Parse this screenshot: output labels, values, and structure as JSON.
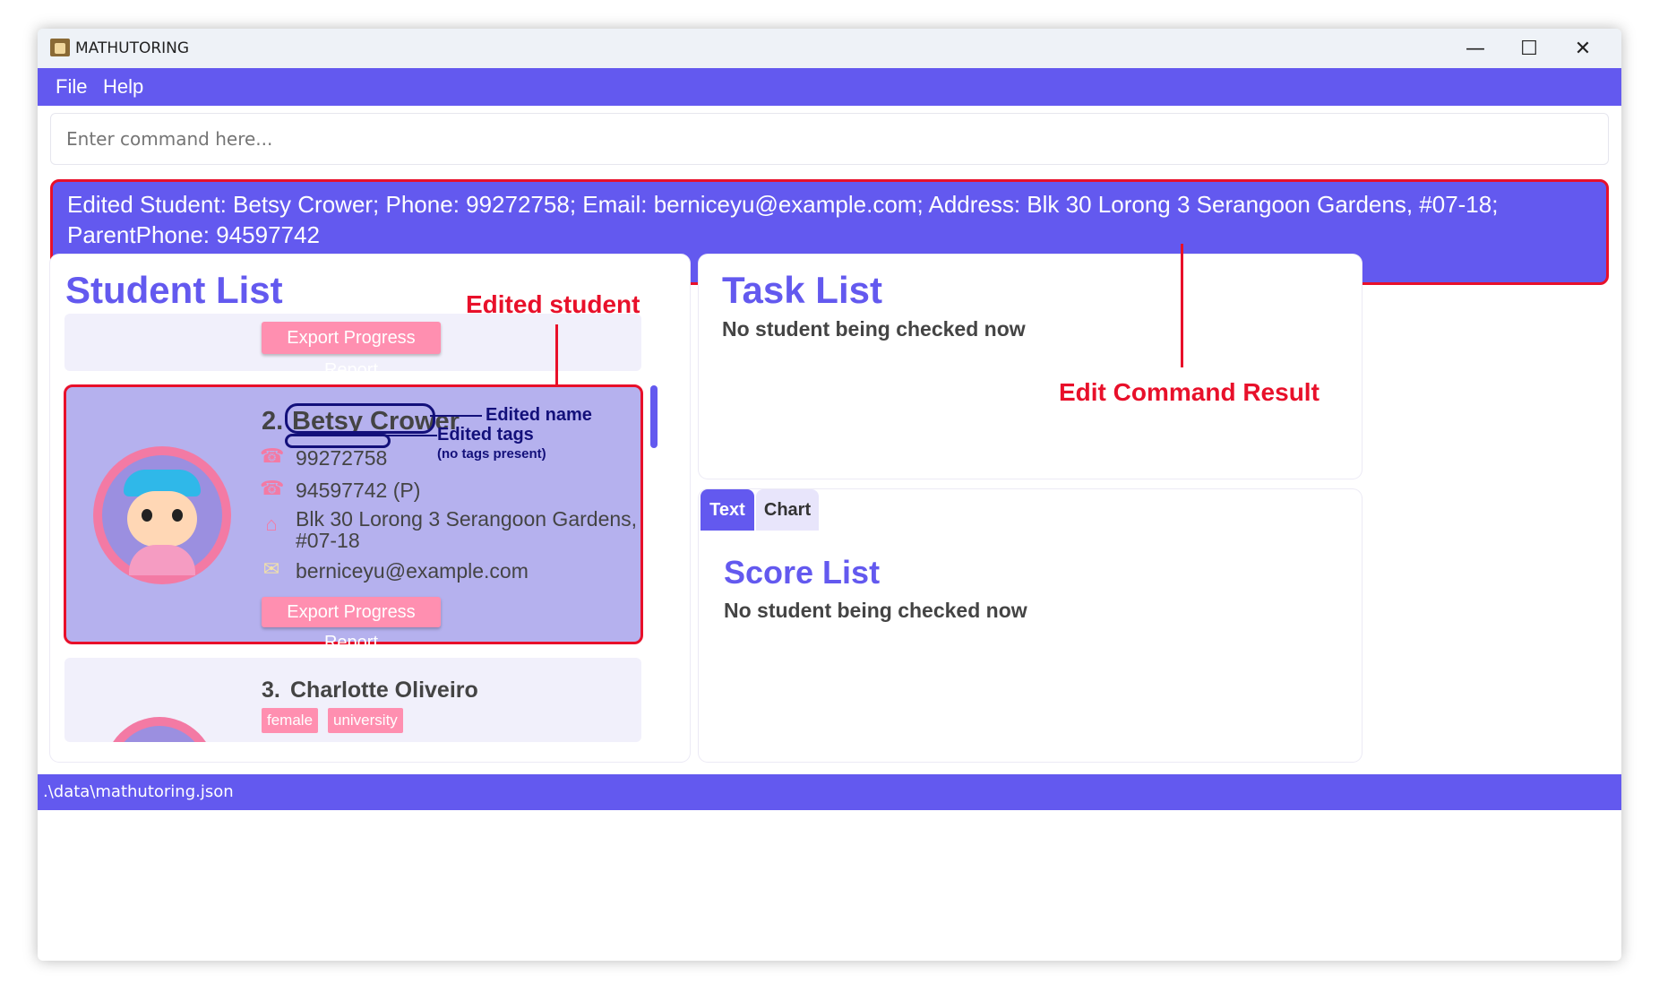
{
  "window": {
    "title": "MATHUTORING"
  },
  "menu": {
    "items": [
      "File",
      "Help"
    ]
  },
  "command": {
    "placeholder": "Enter command here..."
  },
  "result": {
    "text": "Edited Student: Betsy Crower; Phone: 99272758; Email: berniceyu@example.com; Address: Blk 30 Lorong 3 Serangoon Gardens, #07-18; ParentPhone: 94597742"
  },
  "student_list": {
    "title": "Student List",
    "export_label": "Export Progress Report",
    "students": [
      {
        "index": "2.",
        "name": "Betsy Crower",
        "phone": "99272758",
        "parent_phone": "94597742 (P)",
        "address_line1": "Blk 30 Lorong 3 Serangoon Gardens,",
        "address_line2": "#07-18",
        "email": "berniceyu@example.com"
      },
      {
        "index": "3.",
        "name": "Charlotte Oliveiro",
        "tags": [
          "female",
          "university"
        ]
      }
    ]
  },
  "task_list": {
    "title": "Task List",
    "empty_text": "No student being checked now"
  },
  "score_tabs": [
    "Text",
    "Chart"
  ],
  "score_list": {
    "title": "Score List",
    "empty_text": "No student being checked now"
  },
  "annotations": {
    "edited_student": "Edited student",
    "edit_command_result": "Edit Command Result",
    "edited_name": "Edited name",
    "edited_tags": "Edited tags",
    "no_tags": "(no tags present)"
  },
  "status": {
    "path": ".\\data\\mathutoring.json"
  },
  "colors": {
    "accent": "#6359ef",
    "highlight_red": "#e8102a",
    "selected_card": "#b5b1ee",
    "export_button": "#ff8fb0",
    "annotation_navy": "#13107a"
  },
  "icons": [
    "phone-icon",
    "parent-phone-icon",
    "home-icon",
    "envelope-icon",
    "minimize-icon",
    "maximize-icon",
    "close-icon"
  ]
}
